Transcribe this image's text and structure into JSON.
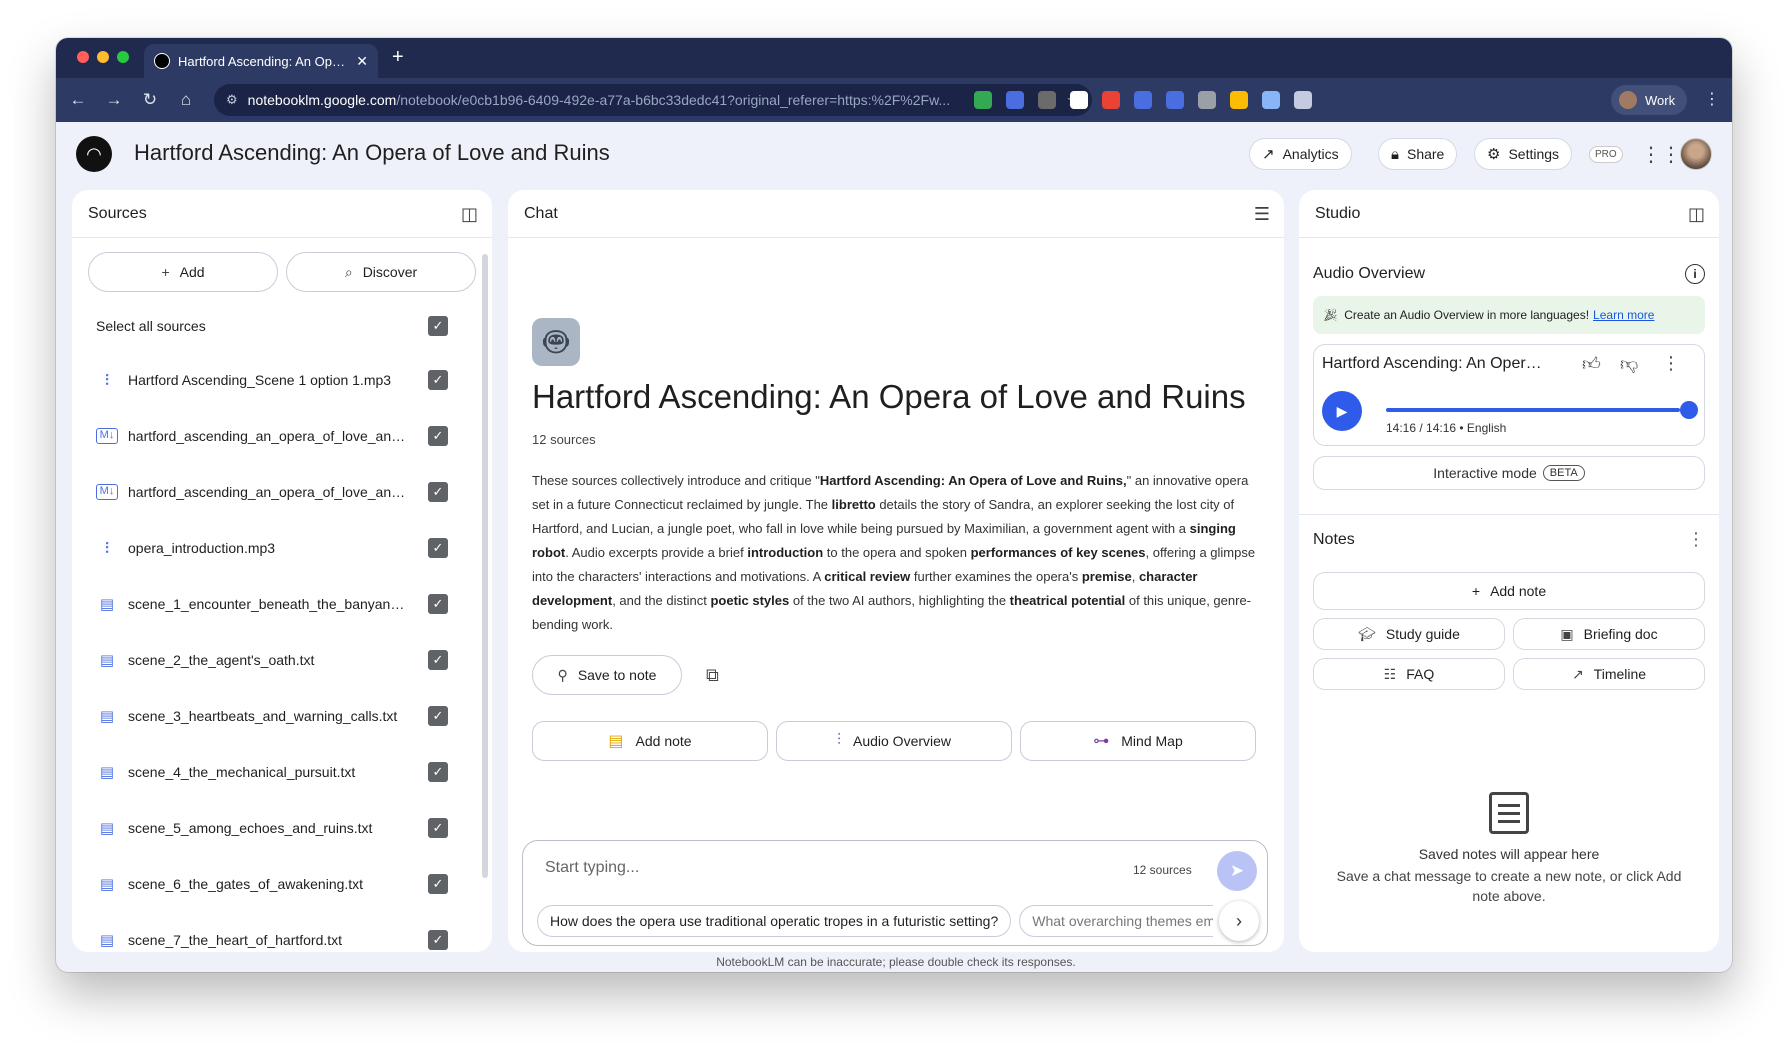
{
  "browser": {
    "tab_title": "Hartford Ascending: An Opera of Love and Ruins",
    "tab_close": "✕",
    "new_tab": "+",
    "url_host": "notebooklm.google.com",
    "url_path": "/notebook/e0cb1b96-6409-492e-a77a-b6bc33dedc41?original_referer=https:%2F%2Fw...",
    "profile_label": "Work",
    "extension_colors": [
      "#34a853",
      "#4a6ee0",
      "#6b6b6b",
      "#ffffff",
      "#ea4335",
      "#4a6ee0",
      "#4a6ee0",
      "#9aa0a6",
      "#fbbc04",
      "#8ab4f8",
      "#c4cbe0"
    ]
  },
  "header": {
    "title": "Hartford Ascending: An Opera of Love and Ruins",
    "analytics_label": "Analytics",
    "share_label": "Share",
    "settings_label": "Settings",
    "pro_badge": "PRO"
  },
  "sources": {
    "title": "Sources",
    "add_label": "Add",
    "discover_label": "Discover",
    "select_all_label": "Select all sources",
    "items": [
      {
        "icon": "audio-icon",
        "name": "Hartford Ascending_Scene 1 option 1.mp3"
      },
      {
        "icon": "markdown-icon",
        "name": "hartford_ascending_an_opera_of_love_and_..."
      },
      {
        "icon": "markdown-icon",
        "name": "hartford_ascending_an_opera_of_love_and_..."
      },
      {
        "icon": "audio-icon",
        "name": "opera_introduction.mp3"
      },
      {
        "icon": "document-icon",
        "name": "scene_1_encounter_beneath_the_banyan_tr..."
      },
      {
        "icon": "document-icon",
        "name": "scene_2_the_agent's_oath.txt"
      },
      {
        "icon": "document-icon",
        "name": "scene_3_heartbeats_and_warning_calls.txt"
      },
      {
        "icon": "document-icon",
        "name": "scene_4_the_mechanical_pursuit.txt"
      },
      {
        "icon": "document-icon",
        "name": "scene_5_among_echoes_and_ruins.txt"
      },
      {
        "icon": "document-icon",
        "name": "scene_6_the_gates_of_awakening.txt"
      },
      {
        "icon": "document-icon",
        "name": "scene_7_the_heart_of_hartford.txt"
      }
    ]
  },
  "chat": {
    "title": "Chat",
    "notebook_title": "Hartford Ascending: An Opera of Love and Ruins",
    "source_count": "12 sources",
    "summary": [
      {
        "t": "These sources collectively introduce and critique \"",
        "b": false
      },
      {
        "t": "Hartford Ascending: An Opera of Love and Ruins,",
        "b": true
      },
      {
        "t": "\" an innovative opera set in a future Connecticut reclaimed by jungle. The ",
        "b": false
      },
      {
        "t": "libretto",
        "b": true
      },
      {
        "t": " details the story of Sandra, an explorer seeking the lost city of Hartford, and Lucian, a jungle poet, who fall in love while being pursued by Maximilian, a government agent with a ",
        "b": false
      },
      {
        "t": "singing robot",
        "b": true
      },
      {
        "t": ". Audio excerpts provide a brief ",
        "b": false
      },
      {
        "t": "introduction",
        "b": true
      },
      {
        "t": " to the opera and spoken ",
        "b": false
      },
      {
        "t": "performances of key scenes",
        "b": true
      },
      {
        "t": ", offering a glimpse into the characters' interactions and motivations. A ",
        "b": false
      },
      {
        "t": "critical review",
        "b": true
      },
      {
        "t": " further examines the opera's ",
        "b": false
      },
      {
        "t": "premise",
        "b": true
      },
      {
        "t": ", ",
        "b": false
      },
      {
        "t": "character development",
        "b": true
      },
      {
        "t": ", and the distinct ",
        "b": false
      },
      {
        "t": "poetic styles",
        "b": true
      },
      {
        "t": " of the two AI authors, highlighting the ",
        "b": false
      },
      {
        "t": "theatrical potential",
        "b": true
      },
      {
        "t": " of this unique, genre-bending work.",
        "b": false
      }
    ],
    "save_to_note_label": "Save to note",
    "actions": {
      "add_note": "Add note",
      "audio_overview": "Audio Overview",
      "mind_map": "Mind Map"
    },
    "input_placeholder": "Start typing...",
    "input_source_count": "12 sources",
    "suggestions": [
      "How does the opera use traditional operatic tropes in a futuristic setting?",
      "What overarching themes emerge from the opera's narrative?"
    ],
    "disclaimer": "NotebookLM can be inaccurate; please double check its responses."
  },
  "studio": {
    "title": "Studio",
    "audio_overview_label": "Audio Overview",
    "banner_text": "Create an Audio Overview in more languages!",
    "banner_link": "Learn more",
    "audio_title": "Hartford Ascending: An Opera of Love and Ruins",
    "progress": 1.0,
    "time_meta": "14:16 / 14:16 • English",
    "interactive_label": "Interactive mode",
    "beta_label": "BETA",
    "notes_title": "Notes",
    "add_note_label": "Add note",
    "study_guide_label": "Study guide",
    "briefing_doc_label": "Briefing doc",
    "faq_label": "FAQ",
    "timeline_label": "Timeline",
    "empty_title": "Saved notes will appear here",
    "empty_sub": "Save a chat message to create a new note, or click Add note above."
  }
}
